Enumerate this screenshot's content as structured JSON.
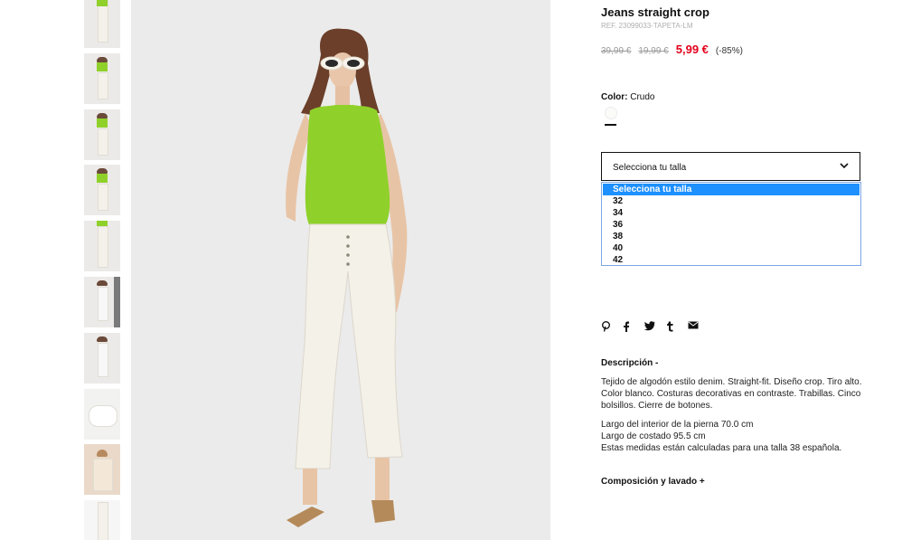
{
  "product": {
    "title": "Jeans straight crop",
    "ref": "REF. 23099033-TAPETA-LM",
    "price_original": "39,99 €",
    "price_previous": "19,99 €",
    "price_current": "5,99 €",
    "discount": "(-85%)",
    "color_label": "Color:",
    "color_value": "Crudo"
  },
  "size_select": {
    "selected": "Selecciona tu talla",
    "options": [
      "Selecciona tu talla",
      "32",
      "34",
      "36",
      "38",
      "40",
      "42"
    ]
  },
  "share_icons": [
    "pinterest-icon",
    "facebook-icon",
    "twitter-icon",
    "tumblr-icon",
    "mail-icon"
  ],
  "description": {
    "heading": "Descripción -",
    "text": "Tejido de algodón estilo denim. Straight-fit. Diseño crop. Tiro alto. Color blanco. Costuras decorativas en contraste. Trabillas. Cinco bolsillos. Cierre de botones.",
    "measure_1": "Largo del interior de la pierna 70.0 cm",
    "measure_2": "Largo de costado 95.5 cm",
    "measure_3": "Estas medidas están calculadas para una talla 38 española."
  },
  "composition": {
    "heading": "Composición y lavado +"
  },
  "colors": {
    "price_red": "#e3001b",
    "select_highlight": "#1e90ff",
    "top_green": "#8fd12a"
  }
}
